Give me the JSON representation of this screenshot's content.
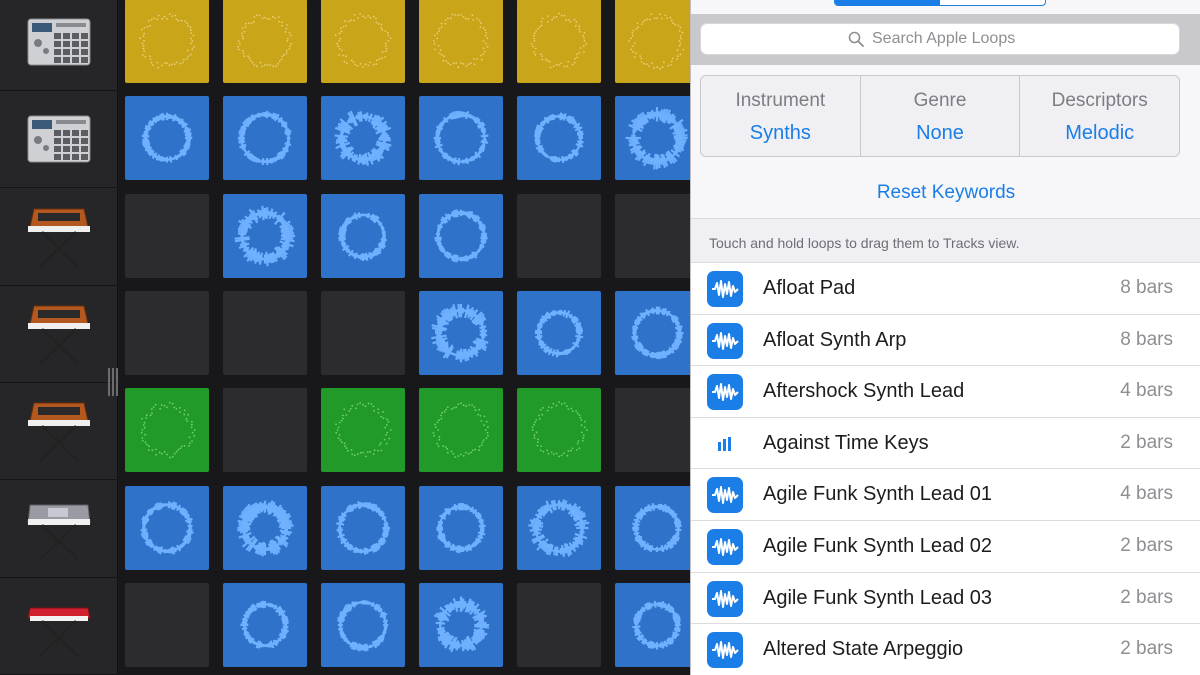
{
  "search": {
    "placeholder": "Search Apple Loops"
  },
  "filters": [
    {
      "label": "Instrument",
      "value": "Synths"
    },
    {
      "label": "Genre",
      "value": "None"
    },
    {
      "label": "Descriptors",
      "value": "Melodic"
    }
  ],
  "reset_label": "Reset Keywords",
  "hint": "Touch and hold loops to drag them to Tracks view.",
  "loops": [
    {
      "name": "Afloat Pad",
      "length": "8 bars",
      "icon": "waveform-icon"
    },
    {
      "name": "Afloat Synth Arp",
      "length": "8 bars",
      "icon": "waveform-icon"
    },
    {
      "name": "Aftershock Synth Lead",
      "length": "4 bars",
      "icon": "waveform-icon"
    },
    {
      "name": "Against Time Keys",
      "length": "2 bars",
      "icon": "midi-bars-icon"
    },
    {
      "name": "Agile Funk Synth Lead 01",
      "length": "4 bars",
      "icon": "waveform-icon"
    },
    {
      "name": "Agile Funk Synth Lead 02",
      "length": "2 bars",
      "icon": "waveform-icon"
    },
    {
      "name": "Agile Funk Synth Lead 03",
      "length": "2 bars",
      "icon": "waveform-icon"
    },
    {
      "name": "Altered State Arpeggio",
      "length": "2 bars",
      "icon": "waveform-icon"
    }
  ],
  "tracks": [
    {
      "instrument": "drum-machine-icon"
    },
    {
      "instrument": "drum-machine-icon"
    },
    {
      "instrument": "synthesizer-icon"
    },
    {
      "instrument": "synthesizer-icon"
    },
    {
      "instrument": "synthesizer-icon"
    },
    {
      "instrument": "workstation-keyboard-icon"
    },
    {
      "instrument": "red-keyboard-icon"
    }
  ],
  "grid": [
    [
      "yellow",
      "yellow",
      "yellow",
      "yellow",
      "yellow",
      "yellow"
    ],
    [
      "blue",
      "blue",
      "blue",
      "blue",
      "blue",
      "blue"
    ],
    [
      "empty",
      "blue",
      "blue",
      "blue",
      "empty",
      "empty"
    ],
    [
      "empty",
      "empty",
      "empty",
      "blue",
      "blue",
      "blue"
    ],
    [
      "green",
      "empty",
      "green",
      "green",
      "green",
      "empty"
    ],
    [
      "blue",
      "blue",
      "blue",
      "blue",
      "blue",
      "blue"
    ],
    [
      "empty",
      "blue",
      "blue",
      "blue",
      "empty",
      "blue"
    ]
  ],
  "colors": {
    "accent": "#1b7ee6",
    "cell_yellow": "#c9a51a",
    "cell_blue": "#2e72c9",
    "cell_green": "#229a2a",
    "cell_empty": "#2c2c2e",
    "wave_blue": "#6fb1ff"
  }
}
